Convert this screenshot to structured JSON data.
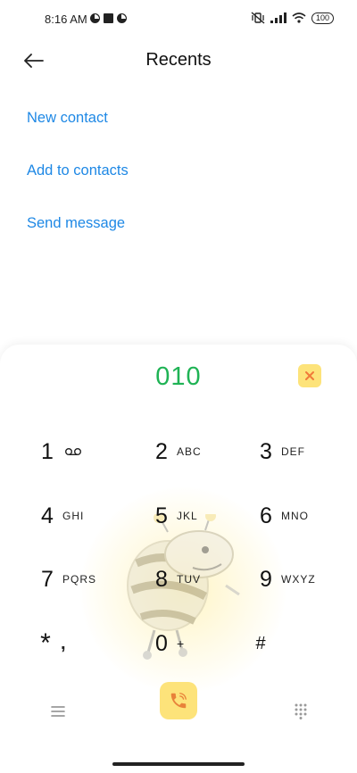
{
  "status_bar": {
    "time": "8:16 AM",
    "battery": "100"
  },
  "header": {
    "title": "Recents"
  },
  "actions": [
    {
      "label": "New contact"
    },
    {
      "label": "Add to contacts"
    },
    {
      "label": "Send message"
    }
  ],
  "dialer": {
    "number": "010",
    "keys": [
      {
        "digit": "1",
        "letters": ""
      },
      {
        "digit": "2",
        "letters": "ABC"
      },
      {
        "digit": "3",
        "letters": "DEF"
      },
      {
        "digit": "4",
        "letters": "GHI"
      },
      {
        "digit": "5",
        "letters": "JKL"
      },
      {
        "digit": "6",
        "letters": "MNO"
      },
      {
        "digit": "7",
        "letters": "PQRS"
      },
      {
        "digit": "8",
        "letters": "TUV"
      },
      {
        "digit": "9",
        "letters": "WXYZ"
      },
      {
        "digit": "*",
        "letters": ","
      },
      {
        "digit": "0",
        "letters": "+"
      },
      {
        "digit": "#",
        "letters": ""
      }
    ],
    "accent_color": "#1fb355",
    "button_color": "#fde37a"
  },
  "icons": {
    "back": "arrow-left-icon",
    "delete": "backspace-x-icon",
    "voicemail": "voicemail-icon",
    "menu": "hamburger-menu-icon",
    "call": "phone-icon",
    "keypad": "keypad-grid-icon"
  }
}
